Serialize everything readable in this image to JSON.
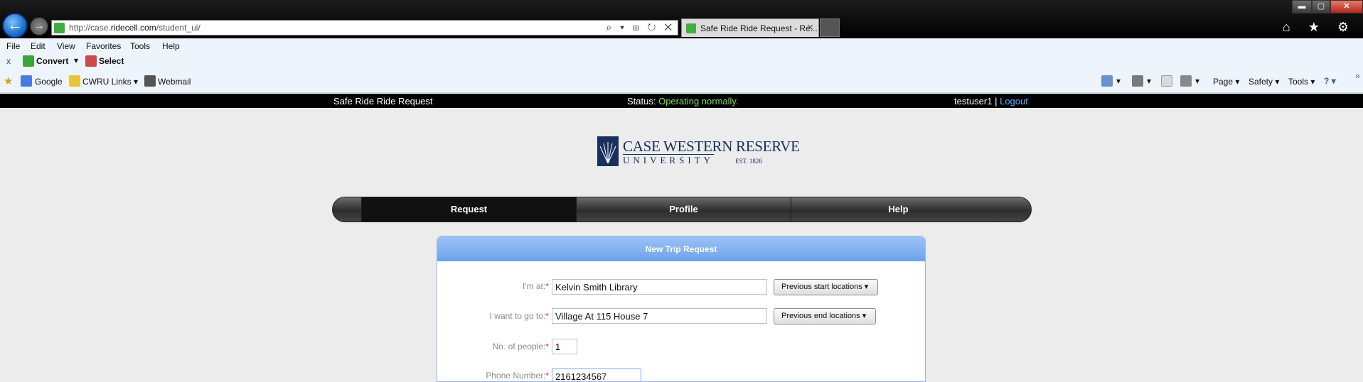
{
  "browser": {
    "url_prefix": "http://case.",
    "url_domain": "ridecell.com",
    "url_path": "/student_ui/",
    "address_tools": "⌕ ▾ ⊞ ↻ ✕",
    "tab_title": "Safe Ride Ride Request - Re...",
    "tab_close": "✕",
    "window_controls": {
      "minimize": "▬",
      "maximize": "▢",
      "close": "✕"
    },
    "chrome_icons": "⌂ ★ ⚙",
    "menu": [
      "File",
      "Edit",
      "View",
      "Favorites",
      "Tools",
      "Help"
    ],
    "command_bar": {
      "close": "x",
      "convert": "Convert",
      "select": "Select"
    },
    "favorites": [
      {
        "label": "Google"
      },
      {
        "label": "CWRU Links ▾"
      },
      {
        "label": "Webmail"
      }
    ],
    "right_tools": {
      "page": "Page ▾",
      "safety": "Safety ▾",
      "tools": "Tools ▾",
      "help": "? ▾",
      "overflow": "»"
    }
  },
  "site": {
    "title": "Safe Ride Ride Request",
    "status_label": "Status: ",
    "status_value": "Operating normally.",
    "username": "testuser1",
    "separator": " | ",
    "logout": "Logout"
  },
  "logo": {
    "name": "CASE WESTERN RESERVE",
    "sub": "UNIVERSITY",
    "est": "EST. 1826"
  },
  "nav": {
    "tabs": [
      {
        "label": "Request",
        "active": true
      },
      {
        "label": "Profile"
      },
      {
        "label": "Help"
      }
    ]
  },
  "form": {
    "panel_title": "New Trip Request",
    "start_label": "I'm at:",
    "start_value": "Kelvin Smith Library",
    "prev_start": "Previous start locations ▾",
    "end_label": "I want to go to:",
    "end_value": "Village At 115 House 7",
    "prev_end": "Previous end locations ▾",
    "people_label": "No. of people:",
    "people_value": "1",
    "phone_label": "Phone Number:",
    "phone_value": "2161234567",
    "required_mark": "*"
  },
  "colors": {
    "status_ok": "#7fe05a",
    "link": "#5fb3ff",
    "panel_header": "#6ea2ee",
    "brand_navy": "#17305e"
  }
}
